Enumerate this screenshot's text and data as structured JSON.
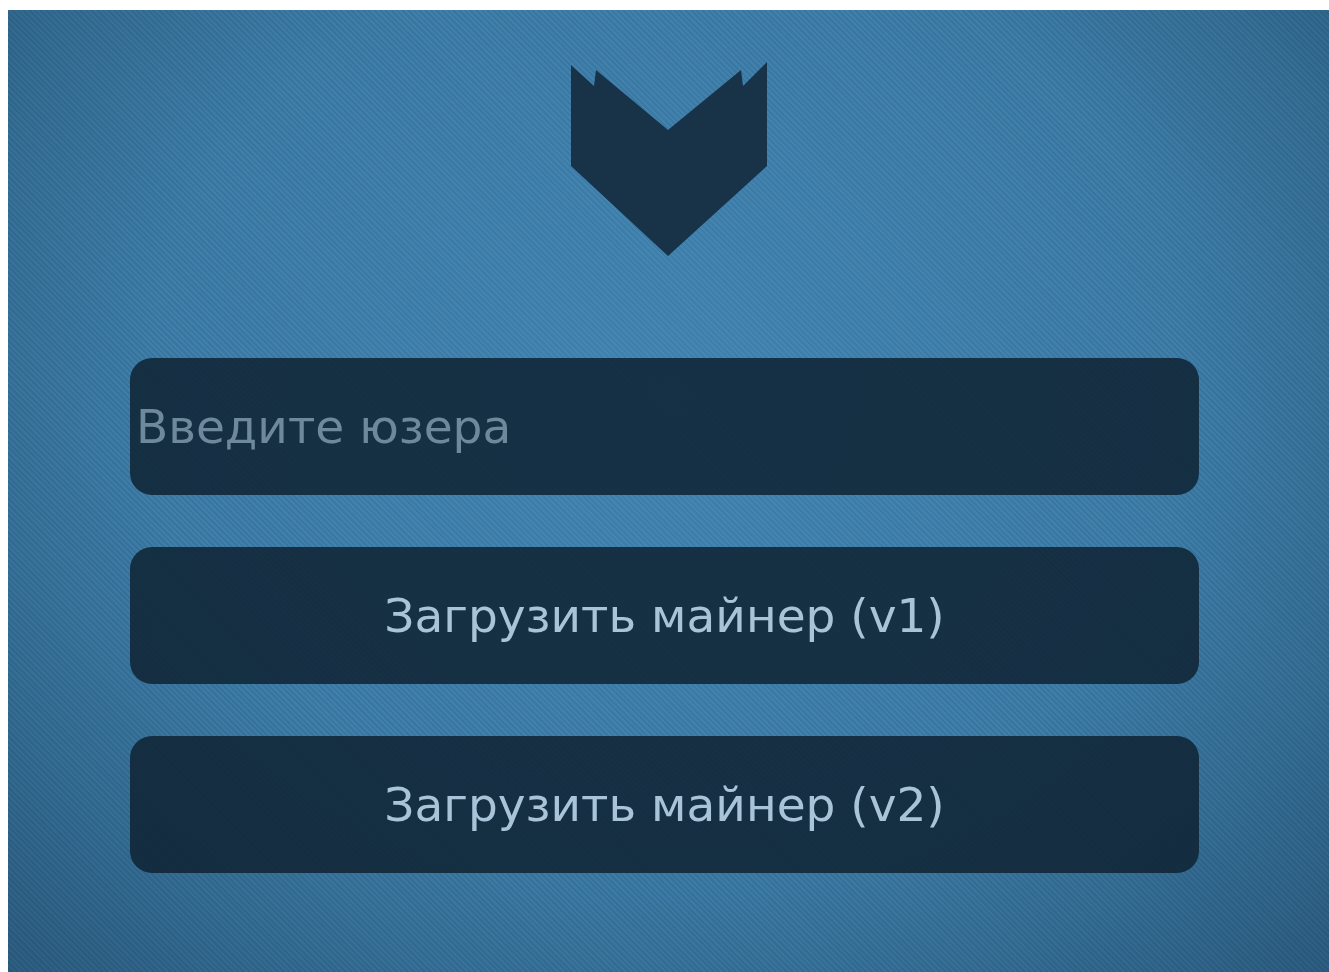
{
  "username_field": {
    "placeholder": "Введите юзера"
  },
  "buttons": [
    "Загрузить майнер (v1)",
    "Загрузить майнер (v2)"
  ]
}
